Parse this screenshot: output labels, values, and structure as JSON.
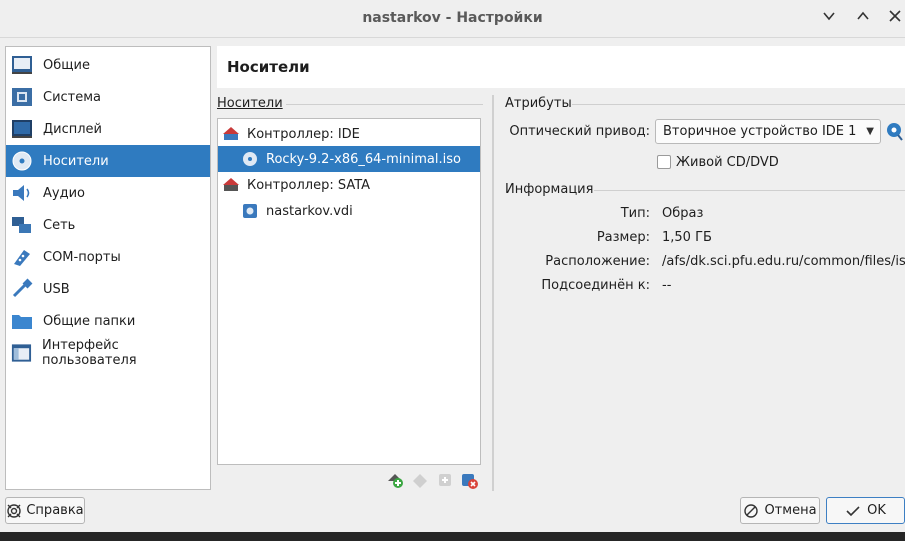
{
  "window": {
    "title": "nastarkov - Настройки"
  },
  "sidebar": {
    "items": [
      {
        "label": "Общие",
        "icon": "general-icon"
      },
      {
        "label": "Система",
        "icon": "system-icon"
      },
      {
        "label": "Дисплей",
        "icon": "display-icon"
      },
      {
        "label": "Носители",
        "icon": "storage-icon",
        "selected": true
      },
      {
        "label": "Аудио",
        "icon": "audio-icon"
      },
      {
        "label": "Сеть",
        "icon": "network-icon"
      },
      {
        "label": "COM-порты",
        "icon": "serial-ports-icon"
      },
      {
        "label": "USB",
        "icon": "usb-icon"
      },
      {
        "label": "Общие папки",
        "icon": "shared-folders-icon"
      },
      {
        "label": "Интерфейс пользователя",
        "icon": "user-interface-icon"
      }
    ]
  },
  "page": {
    "title": "Носители"
  },
  "storage": {
    "group_label": "Носители",
    "tree": [
      {
        "label": "Контроллер: IDE",
        "type": "controller"
      },
      {
        "label": "Rocky-9.2-x86_64-minimal.iso",
        "type": "optical",
        "selected": true
      },
      {
        "label": "Контроллер: SATA",
        "type": "controller"
      },
      {
        "label": "nastarkov.vdi",
        "type": "disk"
      }
    ]
  },
  "attributes": {
    "group_label": "Атрибуты",
    "optical_drive_label": "Оптический привод:",
    "optical_drive_value": "Вторичное устройство IDE 1",
    "live_cd_label": "Живой CD/DVD",
    "live_cd_checked": false
  },
  "information": {
    "group_label": "Информация",
    "rows": [
      {
        "label": "Тип:",
        "value": "Образ"
      },
      {
        "label": "Размер:",
        "value": "1,50 ГБ"
      },
      {
        "label": "Расположение:",
        "value": "/afs/dk.sci.pfu.edu.ru/common/files/is..."
      },
      {
        "label": "Подсоединён к:",
        "value": "--"
      }
    ]
  },
  "buttons": {
    "help": "Справка",
    "cancel": "Отмена",
    "ok": "OK"
  },
  "colors": {
    "selection": "#2f7bc0",
    "ok_border": "#3d7fc3"
  }
}
